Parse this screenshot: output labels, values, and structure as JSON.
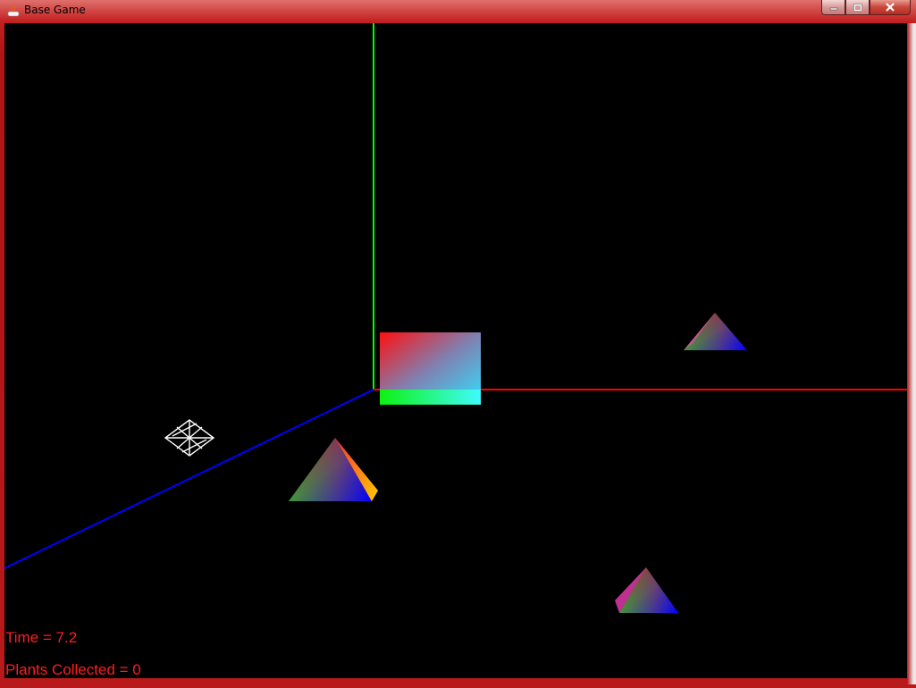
{
  "window": {
    "title": "Base Game",
    "controls": {
      "minimize_icon": "minimize-icon",
      "maximize_icon": "maximize-icon",
      "close_icon": "close-icon"
    },
    "frame_color": "#c01a1a"
  },
  "hud": {
    "time_text": "Time = 7.2",
    "plants_text": "Plants Collected = 0",
    "text_color": "#ff1e1e"
  },
  "scene": {
    "axes": {
      "x_color": "#ff0000",
      "y_color": "#00ff00",
      "z_color": "#0000ff"
    },
    "objects": [
      "plant-pyramid",
      "plant-pyramid",
      "plant-pyramid",
      "gradient-cube",
      "player-wireframe"
    ]
  }
}
